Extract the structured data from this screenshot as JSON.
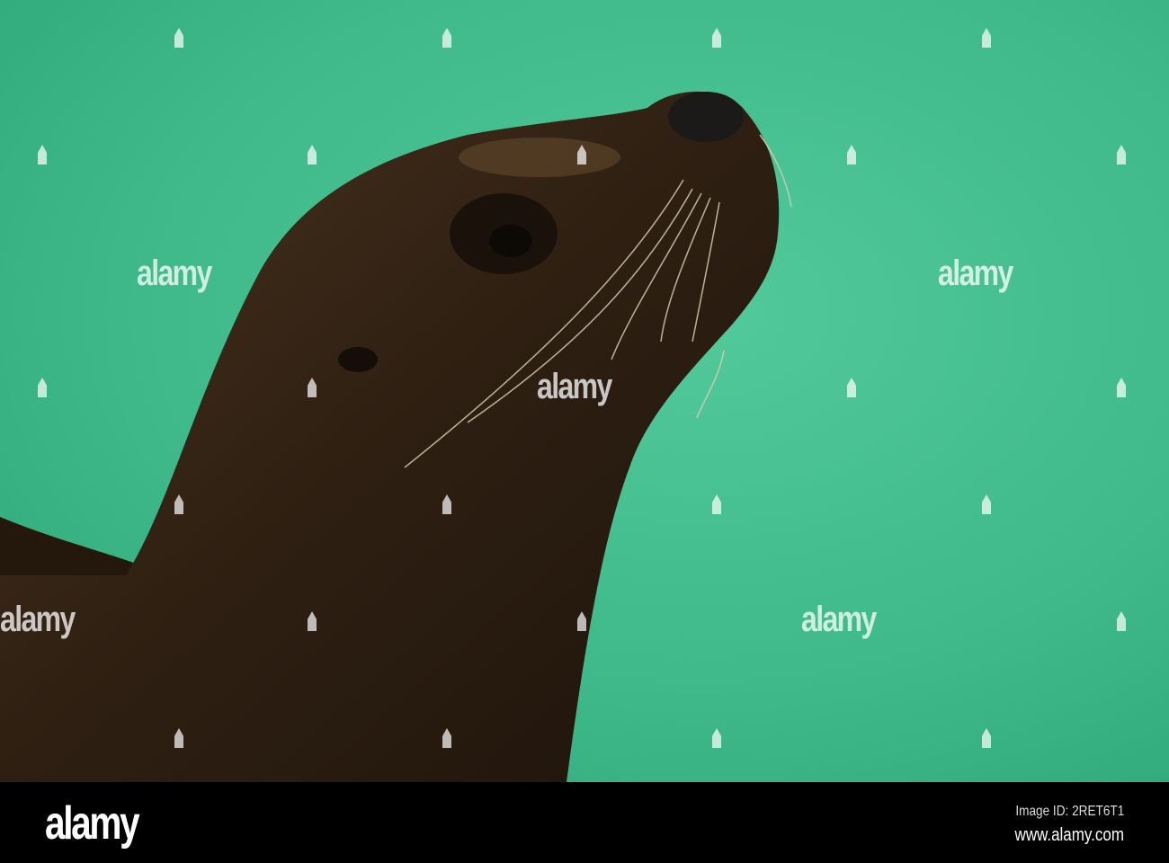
{
  "watermark": {
    "text": "alamy"
  },
  "footer": {
    "logo": "alamy",
    "image_id": "Image ID: 2RET6T1",
    "url": "www.alamy.com"
  },
  "colors": {
    "water": "#3fb98a",
    "seal": "#2e1f12",
    "footer": "#000000"
  }
}
